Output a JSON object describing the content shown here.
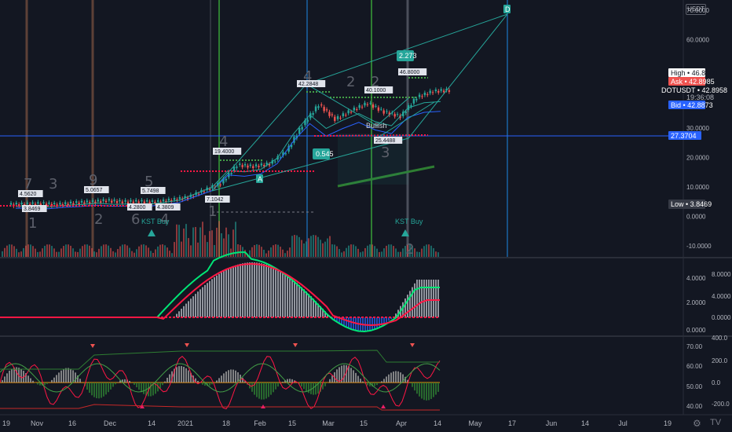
{
  "symbol": "DOTUSDT",
  "currency_badge": "USDT",
  "price_axis": {
    "main_ticks": [
      "70.0000",
      "60.0000",
      "30.0000",
      "20.0000",
      "10.0000",
      "0.0000",
      "-10.0000"
    ],
    "tag_high": "High • 46.8000",
    "tag_ask": "Ask • 42.8985",
    "tag_last_line1": "DOTUSDT • 42.8958",
    "tag_last_line2": "19:36:08",
    "tag_bid": "Bid • 42.8873",
    "tag_cross": "27.3704",
    "tag_low": "Low • 3.8469",
    "macd_ticks": [
      "8.0000",
      "4.0000",
      "2.0000",
      "4.0000",
      "0.0000",
      "0.0000"
    ],
    "rsi_ticks": [
      "400.0",
      "70.00",
      "200.0",
      "60.00",
      "0.0",
      "50.00",
      "-200.0",
      "40.00"
    ]
  },
  "time_axis": [
    "19",
    "Nov",
    "16",
    "Dec",
    "14",
    "2021",
    "18",
    "Feb",
    "15",
    "Mar",
    "15",
    "Apr",
    "14",
    "May",
    "17",
    "Jun",
    "14",
    "Jul",
    "19"
  ],
  "chart_data": {
    "type": "candlestick",
    "symbol": "DOTUSDT",
    "x": [
      "Oct 15",
      "Oct 22",
      "Oct 29",
      "Nov 5",
      "Nov 12",
      "Nov 19",
      "Nov 26",
      "Dec 3",
      "Dec 10",
      "Dec 17",
      "Dec 24",
      "Dec 31",
      "Jan 7",
      "Jan 14",
      "Jan 21",
      "Jan 28",
      "Feb 4",
      "Feb 11",
      "Feb 18",
      "Feb 25",
      "Mar 4",
      "Mar 11",
      "Mar 18",
      "Mar 25",
      "Apr 1",
      "Apr 8",
      "Apr 14"
    ],
    "close": [
      4.2,
      4.4,
      4.0,
      4.6,
      4.9,
      5.4,
      5.0,
      5.1,
      4.9,
      5.6,
      6.5,
      8.9,
      11.2,
      17.5,
      17.0,
      17.9,
      22.0,
      31.0,
      38.0,
      33.0,
      36.0,
      38.5,
      35.5,
      34.0,
      40.5,
      42.5,
      42.9
    ],
    "high_label": "46.8000",
    "low_label": "3.8469",
    "ylim": [
      -10,
      70
    ],
    "annotations": [
      "4.5620",
      "3.8469",
      "5.0657",
      "4.2800",
      "5.7498",
      "4.3809",
      "19.4000",
      "7.1042",
      "42.2848",
      "40.1000",
      "25.4488",
      "46.8000",
      "0.545",
      "2.273",
      "Bullish",
      "KST Buy",
      "KST Buy"
    ],
    "wave_labels": [
      "7",
      "3",
      "1",
      "9",
      "2",
      "5",
      "6",
      "4",
      "4",
      "1",
      "4",
      "2",
      "2",
      "2",
      "3",
      "3",
      "A",
      "D"
    ]
  },
  "colors": {
    "background": "#131722",
    "up": "#26a69a",
    "down": "#ef5350",
    "ema_red": "#ff1744",
    "ema_green": "#00e676",
    "blue_line": "#2962ff",
    "teal_tag": "#26a69a"
  },
  "icons": {
    "settings": "gear-icon",
    "logo": "tradingview-logo"
  }
}
